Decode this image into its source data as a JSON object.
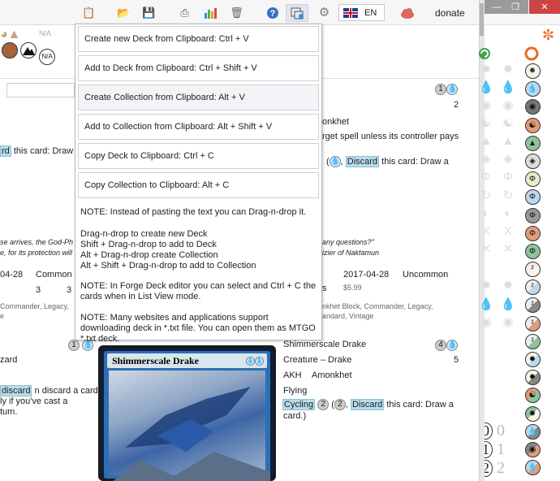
{
  "toolbar": {
    "lang_label": "EN",
    "donate_label": "donate",
    "icons": [
      "paste-icon",
      "open-folder-icon",
      "save-icon",
      "print-icon",
      "chart-icon",
      "trash-icon",
      "help-icon",
      "clipboard-menu-icon",
      "gear-icon",
      "flag-uk-icon",
      "cloud-icon"
    ],
    "window_controls": [
      "minimize",
      "restore",
      "close"
    ]
  },
  "filter_bar": {
    "na1": "N/A",
    "na2": "N/A"
  },
  "background": {
    "left_card": {
      "text_draw": "this card: Draw a",
      "cycling_word": "rd",
      "flavor": "se arrives, the God-Ph",
      "flavor2": "e, for its protection will",
      "date": "04-28",
      "rarity": "Common",
      "num1": "3",
      "num2": "3",
      "formats": "Commander, Legacy,",
      "formats2": "e",
      "name_tail": "zard",
      "discard_text": "n discard a card.",
      "discard_word": "discard",
      "ly_text": "ly if you've cast a",
      "tum_text": "tum."
    },
    "mid_card": {
      "set_tail": "onkhet",
      "counter_text": "rget spell unless its controller pays",
      "cost_num": "1",
      "count": "2",
      "discard_label": "Discard",
      "draw_text": "this card: Draw a",
      "question": "any questions?\"",
      "vizier": "izier of Naktamun",
      "date": "2017-04-28",
      "rarity": "Uncommon",
      "price": "$5.99",
      "s": "s",
      "block": "nkhet Block, Commander, Legacy,",
      "block2": "andard, Vintage"
    },
    "detail_card": {
      "name": "Shimmerscale Drake",
      "type": "Creature – Drake",
      "set_code": "AKH",
      "set_name": "Amonkhet",
      "keyword": "Flying",
      "cycling_label": "Cycling",
      "cycling_cost": "2",
      "cycling_cost2": "2",
      "discard_label": "Discard",
      "draw_text": "this card: Draw a",
      "card_text": "card.)",
      "cmc": "4",
      "count": "5"
    },
    "card_image_title": "Shimmerscale Drake",
    "left_mana": "1"
  },
  "counters": {
    "zero_black": "0",
    "zero_grey": "0",
    "one_black": "1",
    "one_grey": "1",
    "two_black": "2",
    "two_grey": "2"
  },
  "menu": {
    "items": [
      {
        "label": "Create new Deck from Clipboard: Ctrl + V"
      },
      {
        "label": "Add to Deck from Clipboard: Ctrl + Shift + V"
      },
      {
        "label": "Create Collection from Clipboard: Alt + V"
      },
      {
        "label": "Add to Collection from Clipboard: Alt + Shift + V"
      },
      {
        "label": "Copy Deck to Clipboard: Ctrl + C"
      },
      {
        "label": "Copy Collection to Clipboard: Alt + C"
      }
    ],
    "notes": [
      "NOTE: Instead of pasting the text you can Drag-n-drop it.",
      "Drag-n-drop to create new Deck\nShift + Drag-n-drop to add to Deck\nAlt + Drag-n-drop create Collection\nAlt + Shift + Drag-n-drop to add to Collection",
      "NOTE: In Forge Deck editor you can select and Ctrl + C the cards when in List View mode.",
      "NOTE: Many websites and applications support downloading deck in *.txt file. You can open them as MTGO *.txt deck."
    ]
  },
  "colors": {
    "popup_border": "#b9b9b9",
    "highlight": "#b7dcea",
    "card_blue": "#2e6fb3"
  }
}
